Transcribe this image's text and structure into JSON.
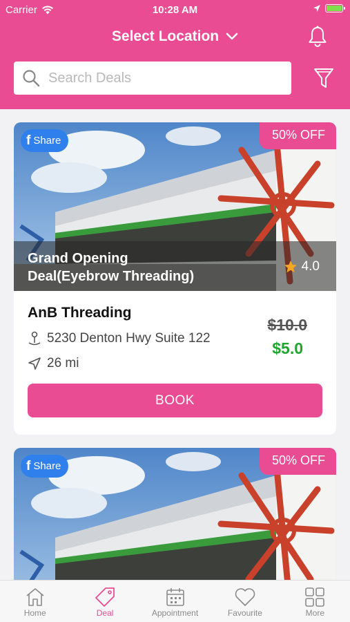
{
  "status_bar": {
    "carrier": "Carrier",
    "time": "10:28 AM"
  },
  "header": {
    "location_label": "Select Location",
    "search_placeholder": "Search Deals"
  },
  "colors": {
    "brand": "#ea4c93",
    "share": "#2f80ed",
    "price_new": "#1fa62f"
  },
  "deals": [
    {
      "share_label": "Share",
      "discount": "50% OFF",
      "title_line1": "Grand Opening",
      "title_line2": "Deal(Eyebrow Threading)",
      "rating": "4.0",
      "shop_name": "AnB Threading",
      "address": "5230 Denton Hwy Suite 122",
      "distance": "26 mi",
      "price_old": "$10.0",
      "price_new": "$5.0",
      "book_label": "BOOK"
    },
    {
      "share_label": "Share",
      "discount": "50% OFF"
    }
  ],
  "tabbar": {
    "items": [
      {
        "label": "Home",
        "icon": "home-icon"
      },
      {
        "label": "Deal",
        "icon": "tag-icon",
        "active": true
      },
      {
        "label": "Appointment",
        "icon": "calendar-icon"
      },
      {
        "label": "Favourite",
        "icon": "heart-icon"
      },
      {
        "label": "More",
        "icon": "grid-icon"
      }
    ]
  }
}
